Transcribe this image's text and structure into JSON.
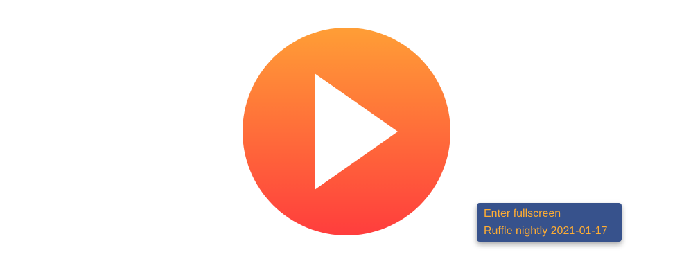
{
  "colors": {
    "play_gradient_top": "#ff9e36",
    "play_gradient_bottom": "#ff3d3d",
    "play_triangle": "#ffffff",
    "menu_background": "#37528c",
    "menu_text": "#ffad33"
  },
  "play_button": {
    "icon": "play-icon"
  },
  "context_menu": {
    "items": [
      {
        "label": "Enter fullscreen"
      },
      {
        "label": "Ruffle nightly 2021-01-17"
      }
    ]
  }
}
